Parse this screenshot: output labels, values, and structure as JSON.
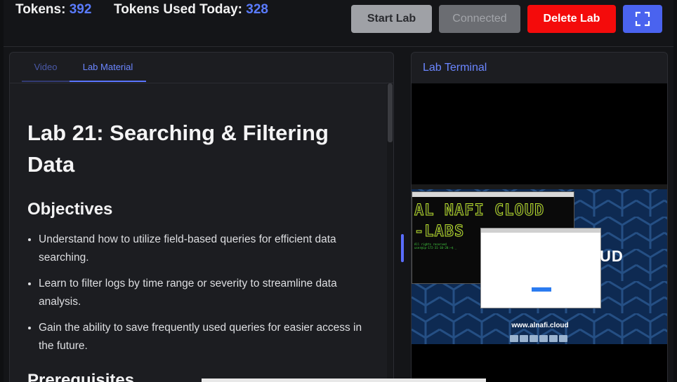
{
  "header": {
    "tokens_label": "Tokens:",
    "tokens_value": "392",
    "tokens_used_label": "Tokens Used Today:",
    "tokens_used_value": "328",
    "start_label": "Start Lab",
    "connected_label": "Connected",
    "delete_label": "Delete Lab"
  },
  "tabs": {
    "video": "Video",
    "lab_material": "Lab Material"
  },
  "content": {
    "title": "Lab 21: Searching & Filtering Data",
    "objectives_heading": "Objectives",
    "objectives": [
      "Understand how to utilize field-based queries for efficient data searching.",
      "Learn to filter logs by time range or severity to streamline data analysis.",
      "Gain the ability to save frequently used queries for easier access in the future."
    ],
    "prerequisites_heading": "Prerequisites"
  },
  "terminal": {
    "title": "Lab Terminal",
    "ascii_line1": "AL NAFI CLOUD",
    "ascii_line2": "-LABS",
    "prompt_line1": "All rights reserved",
    "prompt_line2": "user@ip-172-31-10-20:~$ _",
    "brand_fragment": "UD",
    "url": "www.alnafi.cloud"
  },
  "colors": {
    "accent": "#5a74ff",
    "delete": "#f40b0b",
    "start": "#9fa1a6",
    "connected": "#6b6d72"
  }
}
